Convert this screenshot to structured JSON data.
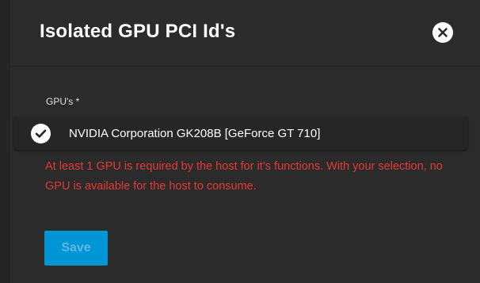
{
  "dialog": {
    "title": "Isolated GPU PCI Id's",
    "close_icon": "close-icon"
  },
  "form": {
    "field_label": "GPU's *",
    "options": [
      {
        "label": "NVIDIA Corporation GK208B [GeForce GT 710]",
        "checked": true,
        "icon": "check-circle-icon"
      }
    ],
    "error_message": "At least 1 GPU is required by the host for it’s functions. With your selection, no GPU is available for the host to consume.",
    "save_label": "Save",
    "save_disabled": true
  },
  "colors": {
    "dialog_bg": "#2b2b2b",
    "error": "#e53935",
    "primary": "#0095d5"
  }
}
